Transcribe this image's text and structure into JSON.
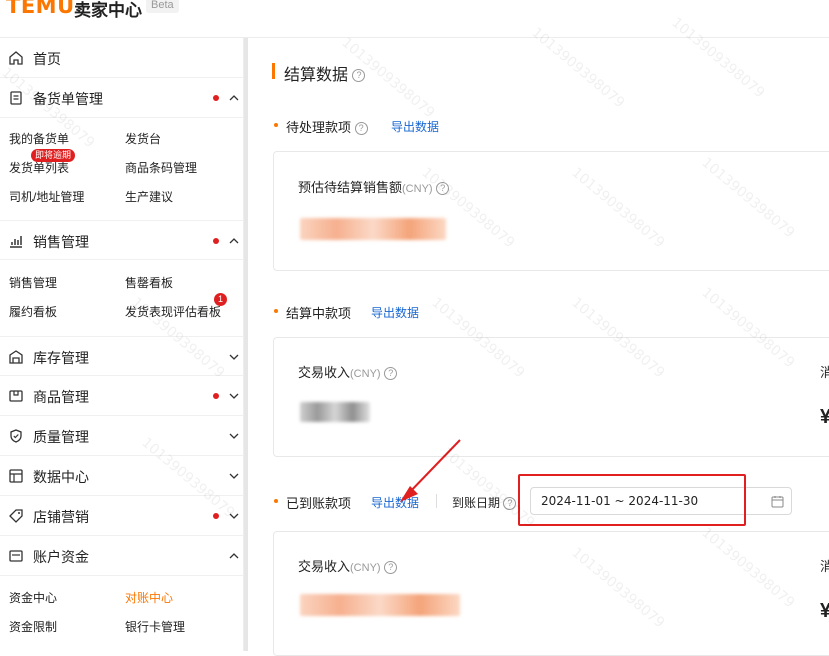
{
  "header": {
    "logo": "TEMU",
    "subtitle": "卖家中心",
    "beta": "Beta"
  },
  "sidebar": {
    "items": [
      {
        "label": "首页",
        "icon": "home-icon"
      },
      {
        "label": "备货单管理",
        "icon": "document-icon",
        "dot": true,
        "expanded": true
      },
      {
        "label": "销售管理",
        "icon": "bar-chart-icon",
        "dot": true,
        "expanded": true
      },
      {
        "label": "库存管理",
        "icon": "warehouse-icon"
      },
      {
        "label": "商品管理",
        "icon": "product-icon",
        "dot": true
      },
      {
        "label": "质量管理",
        "icon": "shield-icon"
      },
      {
        "label": "数据中心",
        "icon": "data-icon"
      },
      {
        "label": "店铺营销",
        "icon": "tag-icon",
        "dot": true
      },
      {
        "label": "账户资金",
        "icon": "wallet-icon",
        "expanded": true
      }
    ],
    "sub_stock": [
      "我的备货单",
      "发货台",
      "发货单列表",
      "商品条码管理",
      "司机/地址管理",
      "生产建议"
    ],
    "stock_badge": "即将逾期",
    "sub_sales": [
      "销售管理",
      "售罄看板",
      "履约看板",
      "发货表现评估看板"
    ],
    "sales_badge": "1",
    "sub_account": [
      "资金中心",
      "对账中心",
      "资金限制",
      "银行卡管理"
    ]
  },
  "main": {
    "title": "结算数据",
    "help": "?",
    "pending": {
      "title": "待处理款项",
      "export": "导出数据",
      "label": "预估待结算销售额",
      "unit": "(CNY)"
    },
    "settling": {
      "title": "结算中款项",
      "export": "导出数据",
      "label": "交易收入",
      "unit": "(CNY)",
      "cut_label": "消",
      "cut_value": "¥"
    },
    "arrived": {
      "title": "已到账款项",
      "export": "导出数据",
      "date_label": "到账日期",
      "date_range": "2024-11-01 ~ 2024-11-30",
      "label": "交易收入",
      "unit": "(CNY)",
      "cut_label": "消",
      "cut_value": "¥"
    }
  },
  "watermark": "1013909398079",
  "colors": {
    "accent": "#fb7701",
    "link": "#1967d2",
    "alert": "#e02020"
  }
}
